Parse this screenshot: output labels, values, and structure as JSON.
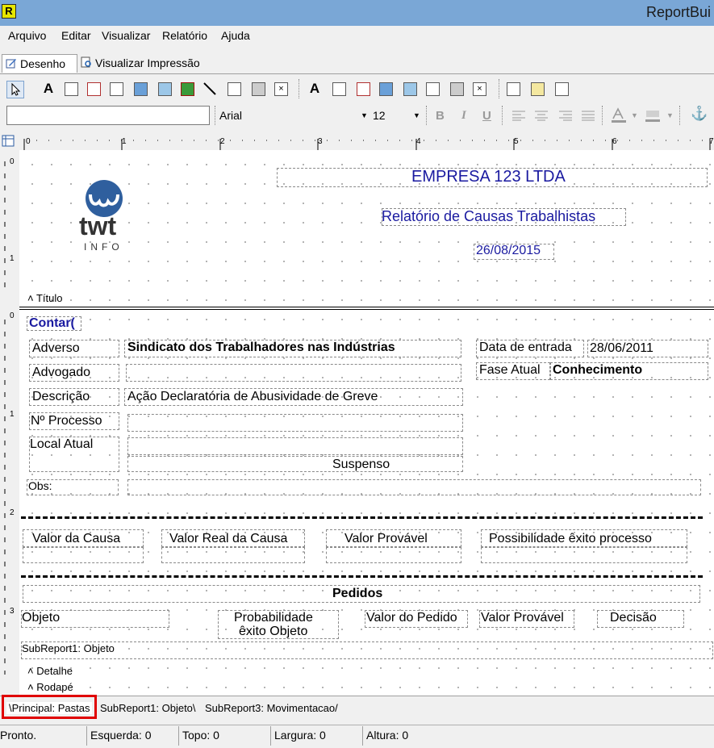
{
  "window": {
    "title": "ReportBui",
    "icon_letter": "R"
  },
  "menu": [
    "Arquivo",
    "Editar",
    "Visualizar",
    "Relatório",
    "Ajuda"
  ],
  "tabs": [
    "Desenho",
    "Visualizar Impressão"
  ],
  "toolbar2": {
    "font": "Arial",
    "size": "12",
    "bold": "B",
    "italic": "I",
    "underline": "U"
  },
  "ruler": {
    "top": [
      "0",
      "1",
      "2",
      "3",
      "4",
      "5",
      "6",
      "7"
    ],
    "left_titulo": [
      "0",
      "1"
    ],
    "left_detalhe": [
      "0",
      "1",
      "2",
      "3"
    ]
  },
  "header": {
    "company": "EMPRESA 123 LTDA",
    "report_title": "Relatório de Causas Trabalhistas",
    "date": "26/08/2015",
    "logo_text": "twt",
    "logo_sub": "INFO",
    "band_label": "Título"
  },
  "detail": {
    "counter": "Contar(",
    "adverso_label": "Adverso",
    "adverso_value": "Sindicato dos Trabalhadores nas Indústrias",
    "data_entrada_label": "Data de entrada",
    "data_entrada_value": "28/06/2011",
    "advogado_label": "Advogado",
    "fase_label": "Fase Atual",
    "fase_value": "Conhecimento",
    "descricao_label": "Descrição",
    "descricao_value": "Ação Declaratória de Abusividade de Greve",
    "processo_label": "Nº Processo",
    "local_label": "Local Atual",
    "suspenso_label": "Suspenso",
    "obs_label": "Obs:",
    "valor_causa": "Valor da Causa",
    "valor_real": "Valor Real da Causa",
    "valor_provavel": "Valor Provável",
    "possibilidade": "Possibilidade êxito processo",
    "pedidos": "Pedidos",
    "objeto": "Objeto",
    "prob_line1": "Probabilidade",
    "prob_line2": "êxito Objeto",
    "valor_pedido": "Valor do Pedido",
    "valor_provavel2": "Valor Provável",
    "decisao": "Decisão",
    "subreport": "SubReport1: Objeto",
    "band_detalhe": "Detalhe",
    "band_rodape": "Rodapé"
  },
  "bottom_tabs": [
    "Principal: Pastas",
    "SubReport1: Objeto",
    "SubReport3: Movimentacao"
  ],
  "status": {
    "state": "Pronto.",
    "esquerda": "Esquerda: 0",
    "topo": "Topo: 0",
    "largura": "Largura: 0",
    "altura": "Altura: 0"
  },
  "colors": {
    "accent_text": "#1a1aa0",
    "highlight": "#e00000",
    "titlebar": "#7aa7d6",
    "logo": "#2f5f9e"
  }
}
